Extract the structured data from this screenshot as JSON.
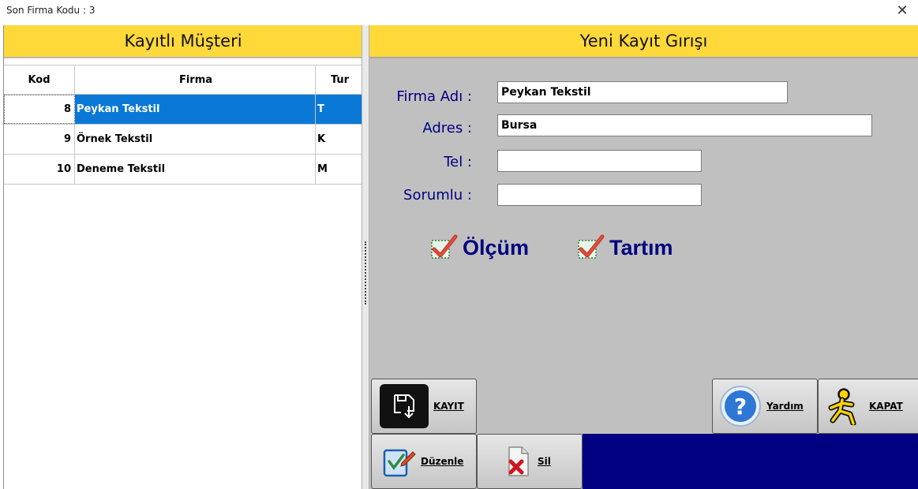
{
  "window": {
    "title": "Son Firma Kodu : 3",
    "close_glyph": "✕"
  },
  "left_panel": {
    "header": "Kayıtlı Müşteri",
    "columns": [
      "Kod",
      "Firma",
      "Tur"
    ],
    "rows": [
      {
        "kod": "8",
        "firma": "Peykan Tekstil",
        "tur": "T",
        "selected": true
      },
      {
        "kod": "9",
        "firma": "Örnek Tekstil",
        "tur": "K",
        "selected": false
      },
      {
        "kod": "10",
        "firma": "Deneme Tekstil",
        "tur": "M",
        "selected": false
      }
    ]
  },
  "right_panel": {
    "header": "Yeni Kayıt Gırışı",
    "form": {
      "firma_label": "Firma Adı :",
      "firma_value": "Peykan Tekstil",
      "adres_label": "Adres :",
      "adres_value": "Bursa",
      "tel_label": "Tel :",
      "tel_value": "",
      "sorumlu_label": "Sorumlu :",
      "sorumlu_value": ""
    },
    "checkboxes": {
      "olcum": "Ölçüm",
      "tartim": "Tartım"
    },
    "buttons": {
      "kayit": "KAYIT",
      "yardim": "Yardım",
      "kapat": "KAPAT",
      "duzenle": "Düzenle",
      "sil": "Sil"
    }
  },
  "colors": {
    "header_yellow": "#ffd83a",
    "form_label_blue": "#000080",
    "selection_blue": "#0a78d7",
    "panel_gray": "#c0c0c0"
  },
  "icons": [
    "close-icon",
    "floppy-save-icon",
    "help-icon",
    "running-man-icon",
    "edit-icon",
    "delete-file-icon",
    "checkmark-icon"
  ]
}
